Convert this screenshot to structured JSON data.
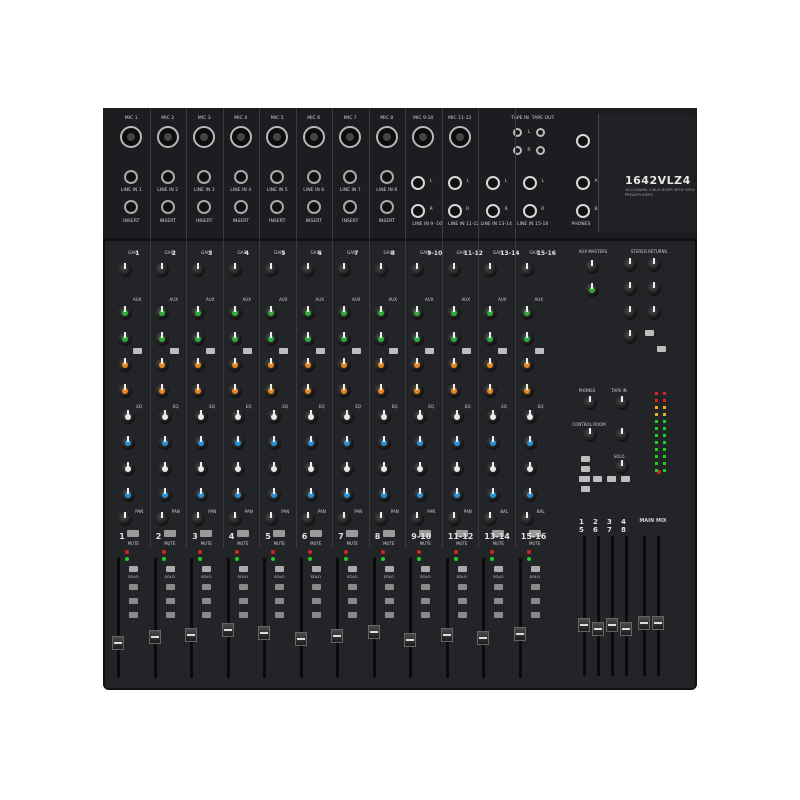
{
  "brand": {
    "model": "1642VLZ4",
    "tagline": "16-CHANNEL 4-BUS MIXER WITH ONYX PREAMPLIFIERS"
  },
  "mic_inputs": [
    "MIC 1",
    "MIC 2",
    "MIC 3",
    "MIC 4",
    "MIC 5",
    "MIC 6",
    "MIC 7",
    "MIC 8",
    "MIC 9-10",
    "MIC 11-12"
  ],
  "line_inputs": [
    "LINE IN 1",
    "LINE IN 2",
    "LINE IN 3",
    "LINE IN 4",
    "LINE IN 5",
    "LINE IN 6",
    "LINE IN 7",
    "LINE IN 8"
  ],
  "insert_label": "INSERT",
  "stereo_line_inputs": [
    "LINE IN 9 -10",
    "LINE IN 11-12",
    "LINE IN 13-14",
    "LINE IN 15-16"
  ],
  "tape": {
    "in": "TAPE IN",
    "out": "TAPE OUT"
  },
  "phones": "PHONES",
  "channels": [
    "1",
    "2",
    "3",
    "4",
    "5",
    "6",
    "7",
    "8",
    "9-10",
    "11-12",
    "13-14",
    "15-16"
  ],
  "channel_labels": {
    "gain": "GAIN",
    "aux": "AUX",
    "eq": "EQ",
    "pan": "PAN",
    "bal": "BAL",
    "mute": "MUTE",
    "solo": "SOLO"
  },
  "master": {
    "aux_masters": "AUX MASTERS",
    "stereo_returns": "STEREO RETURNS",
    "phones": "PHONES",
    "tape_in": "TAPE IN",
    "control_room": "CONTROL ROOM",
    "solo": "SOLO",
    "main_mix": "MAIN MIX",
    "bus_numbers_top": [
      "1",
      "2",
      "3",
      "4"
    ],
    "bus_numbers_bottom": [
      "5",
      "6",
      "7",
      "8"
    ]
  },
  "colors": {
    "panel": "#232427",
    "green_cap": "#2faa3c",
    "orange_cap": "#e8861f",
    "blue_cap": "#2b8fd6",
    "white_cap": "#e8e8e8"
  }
}
